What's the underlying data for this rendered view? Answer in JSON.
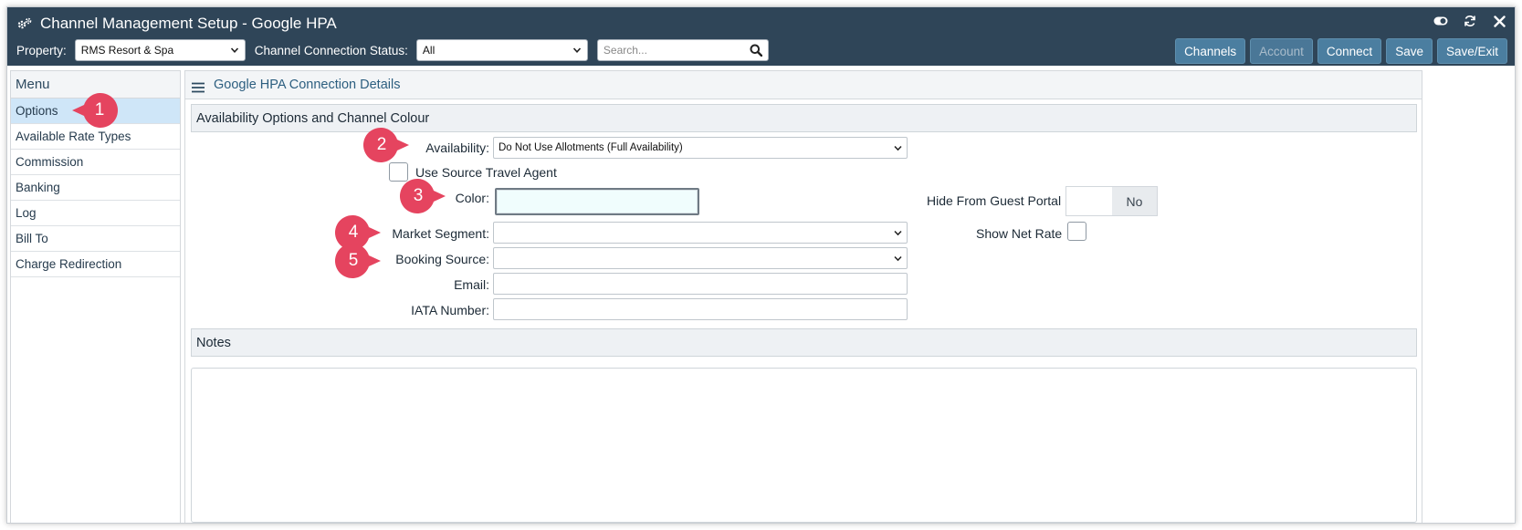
{
  "window": {
    "title": "Channel Management Setup - Google HPA"
  },
  "toolbar": {
    "property_label": "Property:",
    "property_value": "RMS Resort & Spa",
    "status_label": "Channel Connection Status:",
    "status_value": "All",
    "search_placeholder": "Search...",
    "buttons": {
      "channels": "Channels",
      "account": "Account",
      "connect": "Connect",
      "save": "Save",
      "save_exit": "Save/Exit"
    }
  },
  "sidebar": {
    "header": "Menu",
    "items": [
      {
        "label": "Options"
      },
      {
        "label": "Available Rate Types"
      },
      {
        "label": "Commission"
      },
      {
        "label": "Banking"
      },
      {
        "label": "Log"
      },
      {
        "label": "Bill To"
      },
      {
        "label": "Charge Redirection"
      }
    ]
  },
  "main": {
    "header": "Google HPA Connection Details",
    "section1": "Availability Options and Channel Colour",
    "availability_label": "Availability:",
    "availability_value": "Do Not Use Allotments (Full Availability)",
    "use_source_travel_agent": "Use Source Travel Agent",
    "color_label": "Color:",
    "market_segment_label": "Market Segment:",
    "booking_source_label": "Booking Source:",
    "email_label": "Email:",
    "iata_label": "IATA Number:",
    "hide_guest_portal_label": "Hide From Guest Portal",
    "hide_guest_portal_value": "No",
    "show_net_rate_label": "Show Net Rate",
    "notes_section": "Notes"
  },
  "callouts": [
    "1",
    "2",
    "3",
    "4",
    "5"
  ],
  "colors": {
    "titlebar": "#2f4558",
    "button": "#4b7ea0",
    "callout": "#e5445f",
    "active_menu": "#cfe6f8",
    "color_field": "#f0fdfd"
  }
}
